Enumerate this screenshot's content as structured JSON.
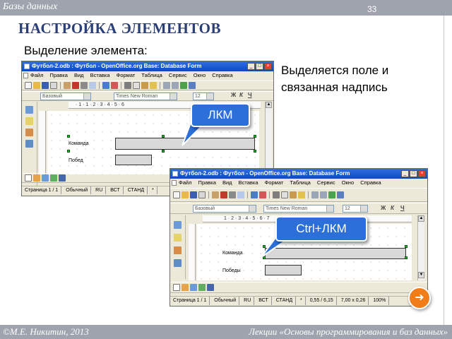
{
  "header": {
    "title": "Базы данных",
    "slide_number": "33",
    "heading": "НАСТРОЙКА ЭЛЕМЕНТОВ"
  },
  "subtitle": "Выделение элемента:",
  "explanation": "Выделяется поле и связанная надпись",
  "callouts": {
    "click": "ЛКМ",
    "ctrl_click": "Ctrl+ЛКМ"
  },
  "window1": {
    "title": "Футбол-2.odb : Футбол - OpenOffice.org Base: Database Form",
    "menu": [
      "Файл",
      "Правка",
      "Вид",
      "Вставка",
      "Формат",
      "Таблица",
      "Сервис",
      "Окно",
      "Справка"
    ],
    "style_value": "Базовый",
    "font_value": "Times New Roman",
    "size_value": "12",
    "ruler": "· 1 · 1 · 2 · 3 · 4 · 5 · 6",
    "labels": {
      "team": "Команда",
      "wins": "Побед"
    },
    "status": [
      "Страница 1 / 1",
      "Обычный",
      "RU",
      "ВСТ",
      "СТАНД",
      "*"
    ]
  },
  "window2": {
    "title": "Футбол-2.odb : Футбол - OpenOffice.org Base: Database Form",
    "menu": [
      "Файл",
      "Правка",
      "Вид",
      "Вставка",
      "Формат",
      "Таблица",
      "Сервис",
      "Окно",
      "Справка"
    ],
    "style_value": "Базовый",
    "font_value": "Times New Roman",
    "size_value": "12",
    "ruler": "1 · 2 · 3 · 4 · 5 · 6 · 7",
    "labels": {
      "team": "Команда",
      "wins": "Победы"
    },
    "status": [
      "Страница 1 / 1",
      "Обычный",
      "RU",
      "ВСТ",
      "СТАНД",
      "*",
      "0,55 / 6,15",
      "7,00 x 0,26"
    ],
    "zoom": "100%"
  },
  "footer": {
    "left": "©М.Е. Никитин, 2013",
    "right": "Лекции «Основы программирования и баз данных»"
  },
  "colors": {
    "accent": "#2c6fd8",
    "heading": "#2a3e78",
    "bar": "#9ea3ad",
    "handle": "#27b53a",
    "nav": "#f07d1a"
  }
}
